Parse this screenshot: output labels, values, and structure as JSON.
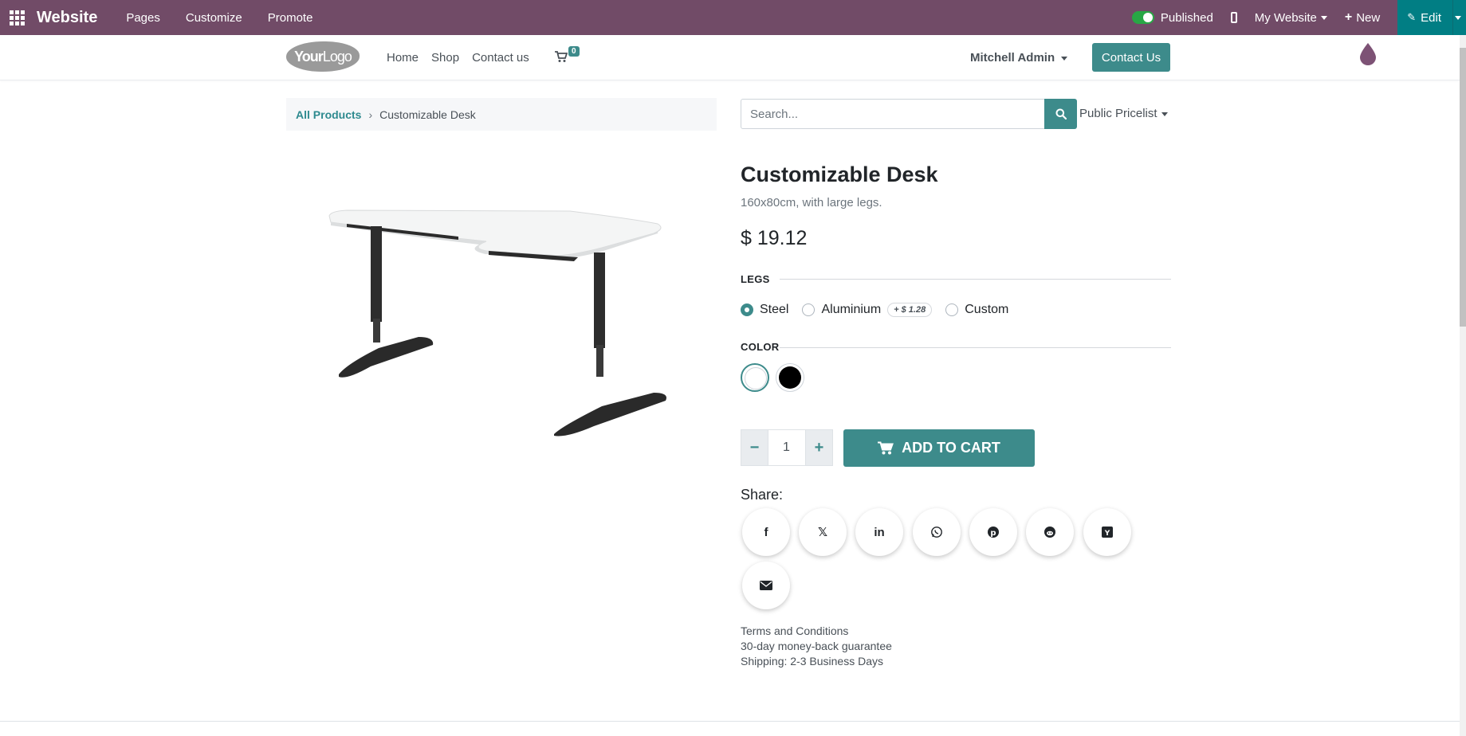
{
  "topbar": {
    "brand": "Website",
    "menu": [
      "Pages",
      "Customize",
      "Promote"
    ],
    "published_label": "Published",
    "my_website_label": "My Website",
    "new_label": "New",
    "edit_label": "Edit"
  },
  "header": {
    "logo_text_bold": "Your",
    "logo_text": "Logo",
    "nav": [
      "Home",
      "Shop",
      "Contact us"
    ],
    "cart_count": "0",
    "user_name": "Mitchell Admin",
    "contact_button": "Contact Us"
  },
  "breadcrumb": {
    "root": "All Products",
    "separator": "›",
    "current": "Customizable Desk"
  },
  "search": {
    "placeholder": "Search..."
  },
  "pricelist": "Public Pricelist",
  "product": {
    "name": "Customizable Desk",
    "description": "160x80cm, with large legs.",
    "price": "$ 19.12",
    "legs_label": "LEGS",
    "legs_options": [
      {
        "label": "Steel",
        "checked": true
      },
      {
        "label": "Aluminium",
        "checked": false,
        "extra": "+ $ 1.28"
      },
      {
        "label": "Custom",
        "checked": false
      }
    ],
    "color_label": "COLOR",
    "colors": [
      "#ffffff",
      "#000000"
    ],
    "selected_color": "#ffffff",
    "quantity": "1",
    "add_to_cart": "ADD TO CART"
  },
  "share": {
    "label": "Share:",
    "icons": [
      "facebook-icon",
      "x-twitter-icon",
      "linkedin-icon",
      "whatsapp-icon",
      "pinterest-icon",
      "reddit-icon",
      "hackernews-icon",
      "email-icon"
    ]
  },
  "info": {
    "terms": "Terms and Conditions",
    "guarantee": "30-day money-back guarantee",
    "shipping": "Shipping: 2-3 Business Days"
  },
  "colors": {
    "topbar_bg": "#714b67",
    "accent": "#3d8b8b",
    "edit_bg": "#017e84"
  }
}
